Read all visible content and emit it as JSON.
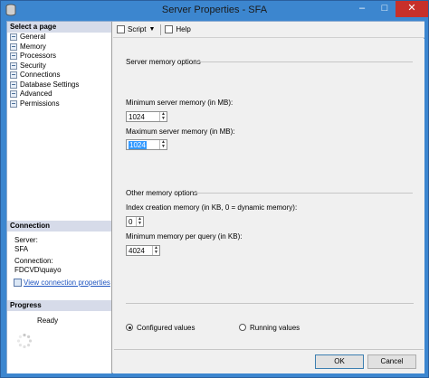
{
  "window": {
    "title": "Server Properties - SFA",
    "minimize": "–",
    "maximize": "□",
    "close": "✕"
  },
  "left": {
    "select_page_header": "Select a page",
    "pages": [
      "General",
      "Memory",
      "Processors",
      "Security",
      "Connections",
      "Database Settings",
      "Advanced",
      "Permissions"
    ],
    "connection_header": "Connection",
    "server_label": "Server:",
    "server_value": "SFA",
    "connection_label": "Connection:",
    "connection_value": "FDCVD\\quayo",
    "view_link": "View connection properties",
    "progress_header": "Progress",
    "progress_status": "Ready"
  },
  "toolbar": {
    "script_label": "Script",
    "help_label": "Help"
  },
  "main": {
    "server_memory_group": "Server memory options",
    "min_label": "Minimum server memory (in MB):",
    "min_value": "1024",
    "max_label": "Maximum server memory (in MB):",
    "max_value": "1024",
    "other_memory_group": "Other memory options",
    "index_label": "Index creation memory (in KB, 0 = dynamic memory):",
    "index_value": "0",
    "query_label": "Minimum memory per query (in KB):",
    "query_value": "4024"
  },
  "radios": {
    "configured": "Configured values",
    "running": "Running values",
    "selected": "configured"
  },
  "buttons": {
    "ok": "OK",
    "cancel": "Cancel"
  }
}
